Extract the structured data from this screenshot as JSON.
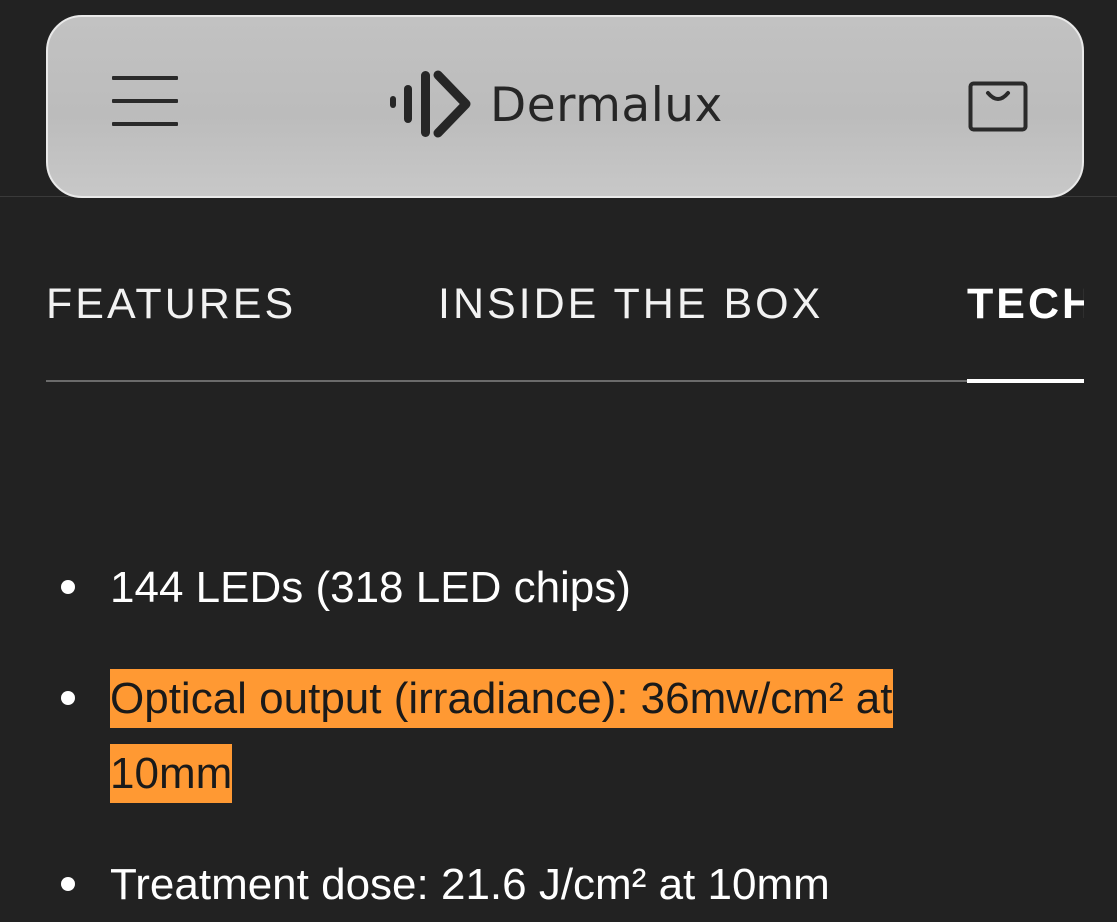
{
  "brand": {
    "name": "Dermalux"
  },
  "tabs": [
    {
      "label": "FEATURES",
      "active": false
    },
    {
      "label": "INSIDE THE BOX",
      "active": false
    },
    {
      "label": "TECH",
      "active": true
    }
  ],
  "specs": [
    {
      "text": "144 LEDs (318 LED chips)",
      "highlighted": false
    },
    {
      "text": "Optical output (irradiance): 36mw/cm² at 10mm",
      "highlighted": true
    },
    {
      "text": "Treatment dose: 21.6 J/cm² at 10mm",
      "highlighted": false
    }
  ],
  "icons": {
    "menu": "hamburger-menu-icon",
    "cart": "shopping-bag-icon",
    "logo": "dermalux-logo-icon"
  },
  "colors": {
    "background": "#222222",
    "header": "#c2c2c2",
    "highlight": "#ff9933",
    "text": "#ffffff"
  }
}
